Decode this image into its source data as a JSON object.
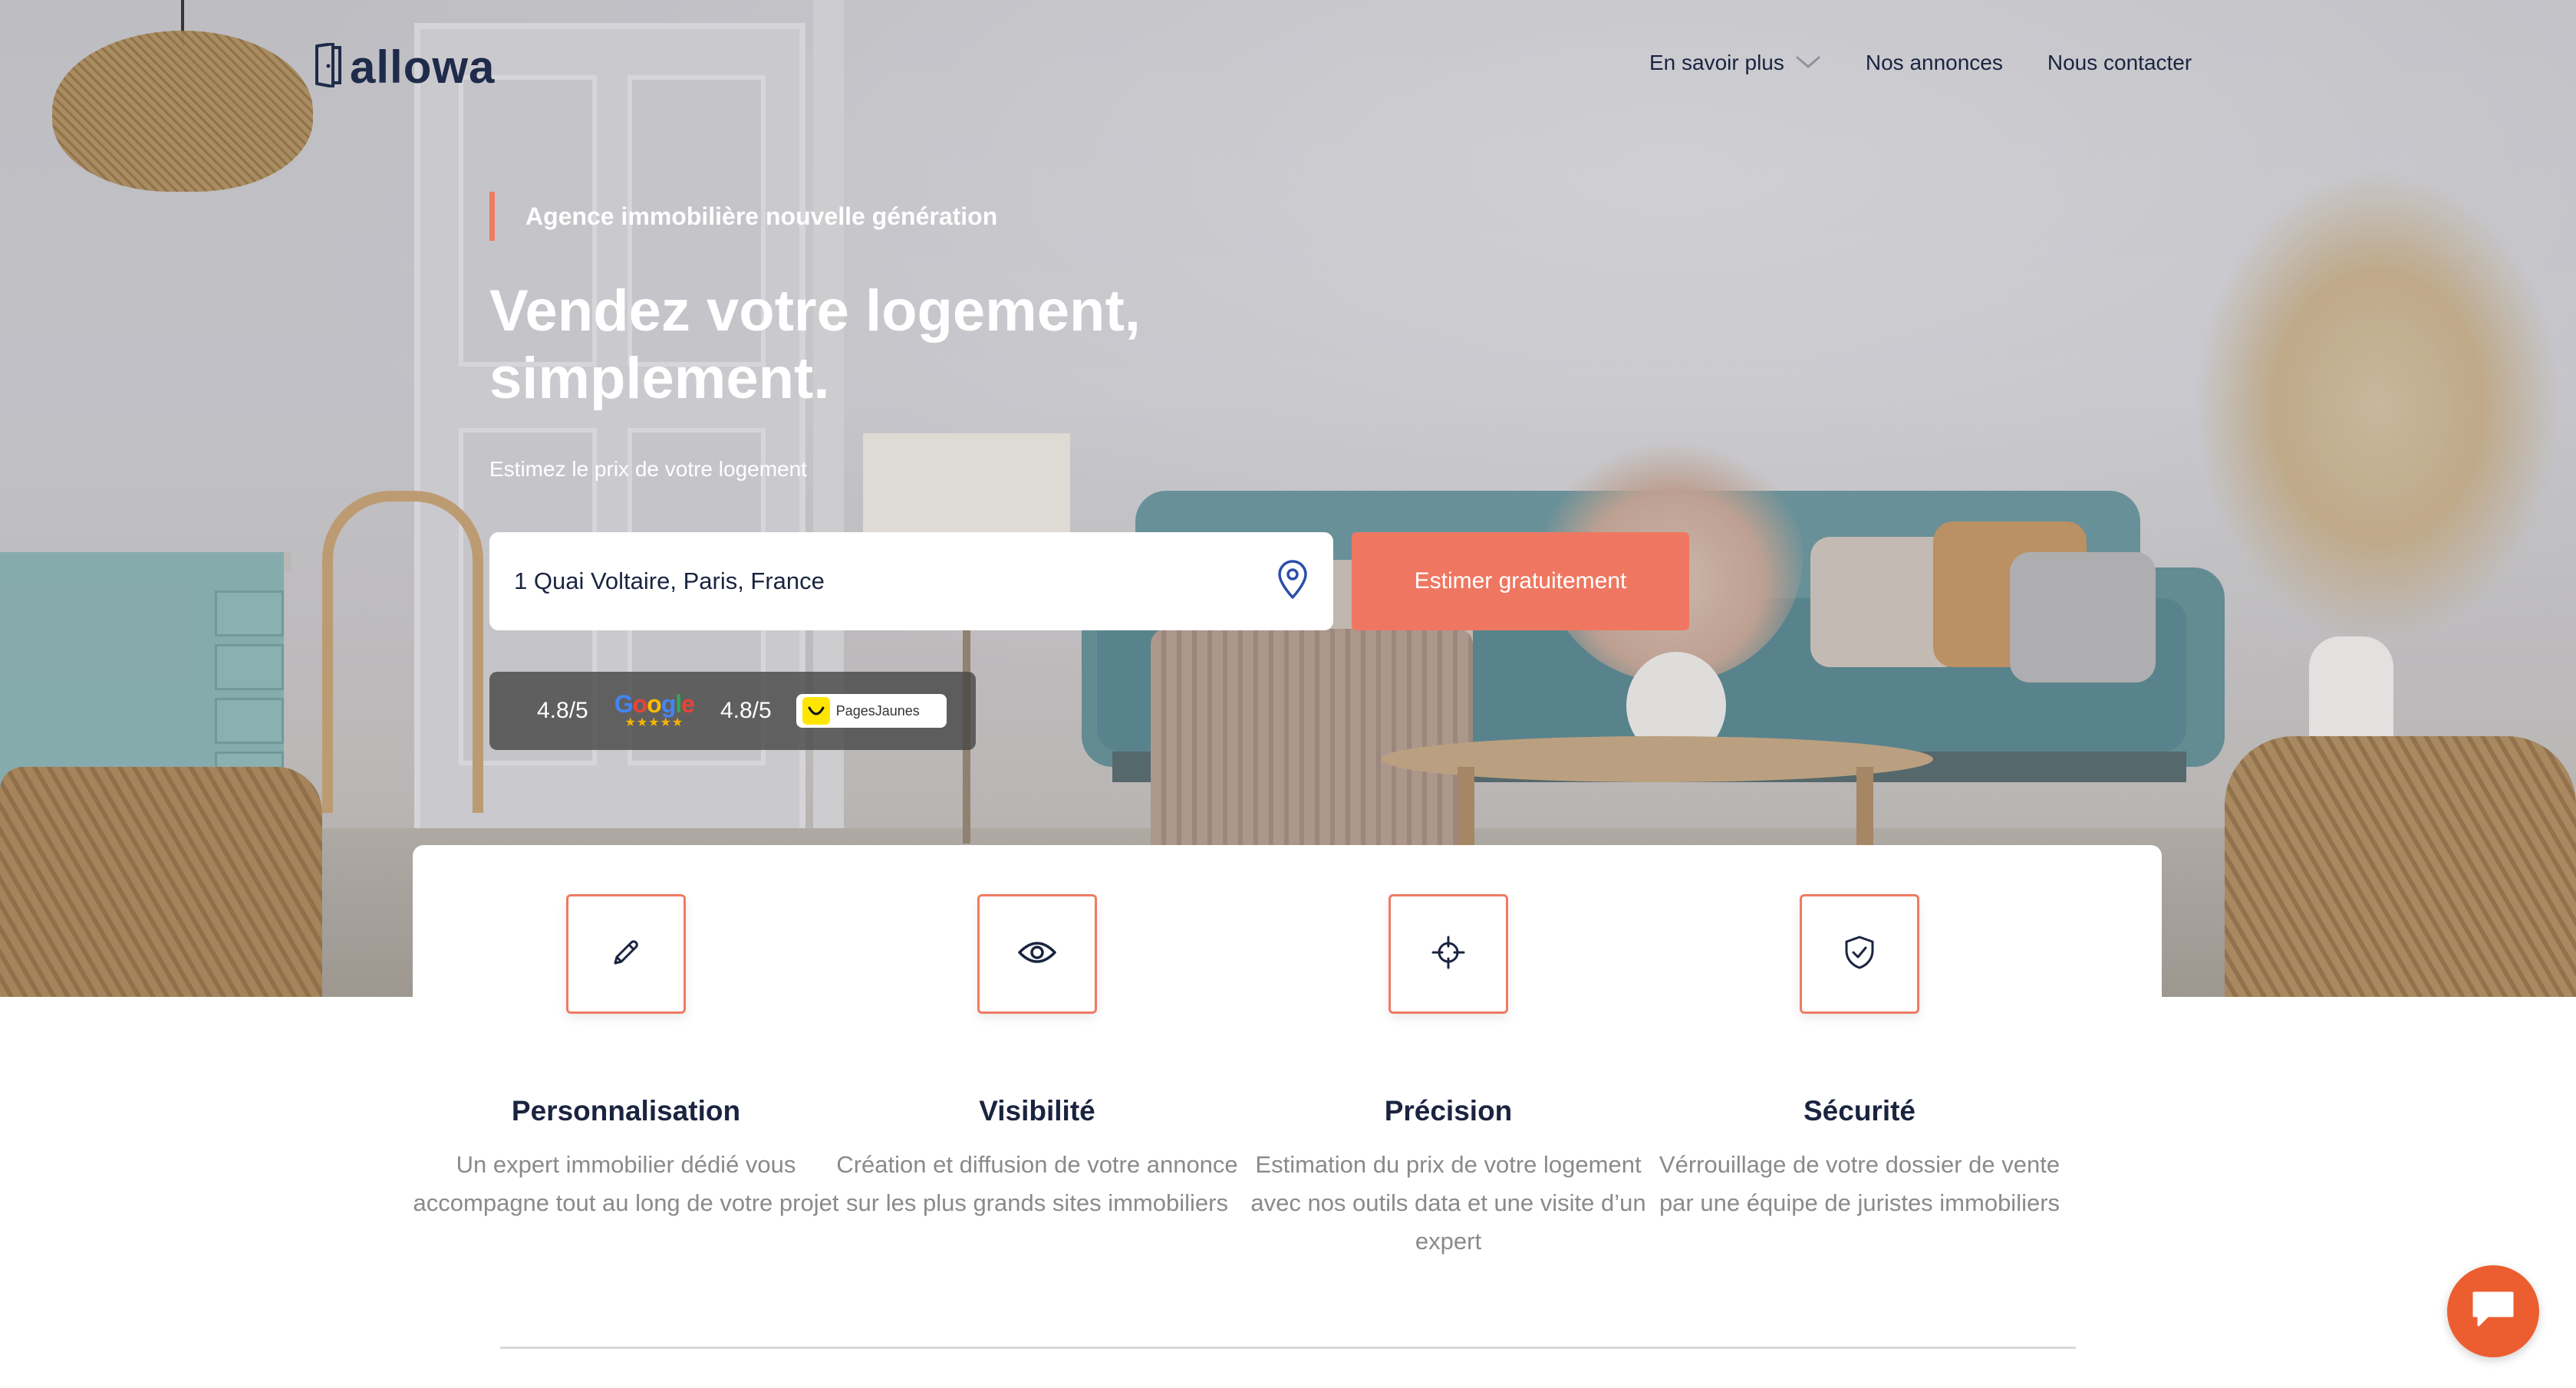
{
  "header": {
    "logo_text": "allowa",
    "nav": [
      {
        "label": "En savoir plus"
      },
      {
        "label": "Nos annonces"
      },
      {
        "label": "Nous contacter"
      }
    ]
  },
  "hero": {
    "tagline": "Agence immobilière nouvelle génération",
    "headline": "Vendez votre logement, simplement.",
    "subtitle": "Estimez le prix de votre logement",
    "address_value": "1 Quai Voltaire, Paris, France",
    "cta_label": "Estimer gratuitement",
    "ratings": [
      {
        "value": "4.8/5",
        "source": "Google"
      },
      {
        "value": "4.8/5",
        "source": "PagesJaunes"
      }
    ]
  },
  "features": [
    {
      "icon": "pencil-icon",
      "title": "Personnalisation",
      "desc": "Un expert immobilier dédié vous accompagne tout au long de votre projet"
    },
    {
      "icon": "eye-icon",
      "title": "Visibilité",
      "desc": "Création et diffusion de votre annonce sur les plus grands sites immobiliers"
    },
    {
      "icon": "crosshair-icon",
      "title": "Précision",
      "desc": "Estimation du prix de votre logement avec nos outils data et une visite d’un expert"
    },
    {
      "icon": "shield-check-icon",
      "title": "Sécurité",
      "desc": "Vérrouillage de votre dossier de vente par une équipe de juristes immobiliers"
    }
  ],
  "colors": {
    "accent": "#ef7761",
    "navy": "#1a2440",
    "chat": "#ec5e2f"
  }
}
